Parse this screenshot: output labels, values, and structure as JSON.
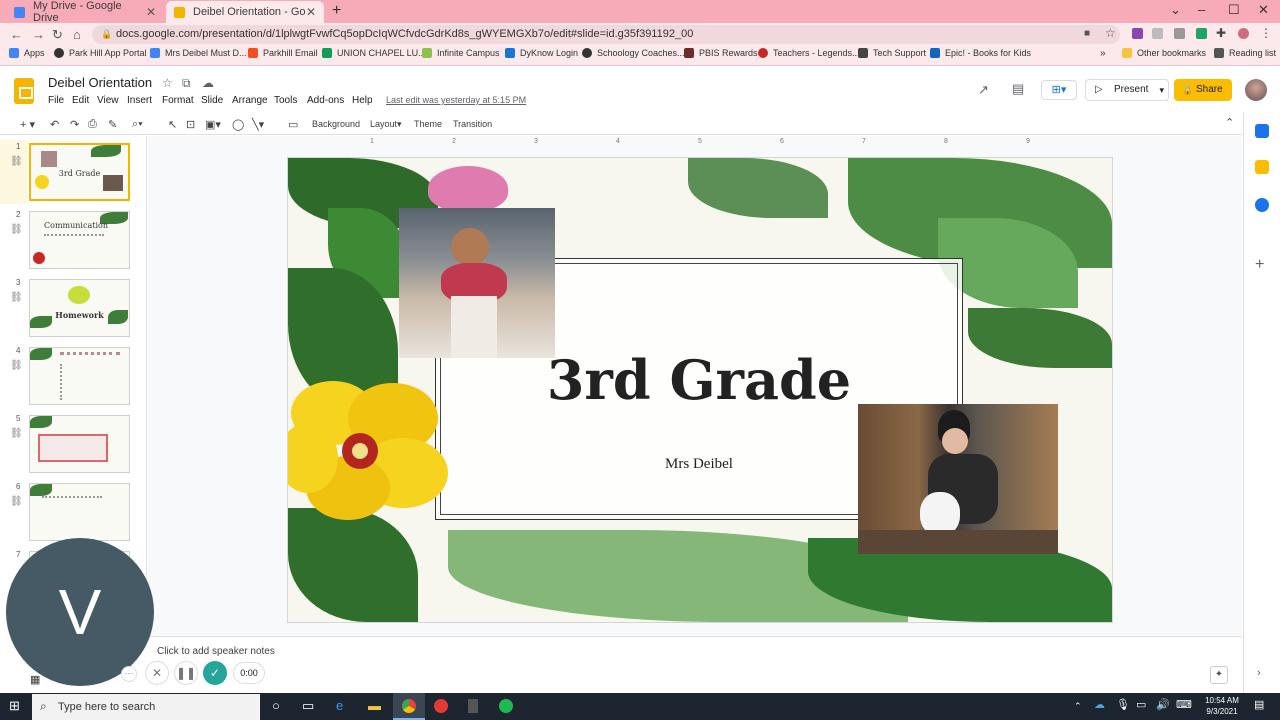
{
  "browser": {
    "tabs": [
      {
        "title": "My Drive - Google Drive",
        "color": "#4285f4"
      },
      {
        "title": "Deibel Orientation - Google Slid",
        "color": "#f4b400"
      }
    ],
    "url": "docs.google.com/presentation/d/1lplwgtFvwfCq5opDcIqWCfvdcGdrKd8s_gWYEMGXb7o/edit#slide=id.g35f391192_00",
    "bookmarks": [
      "Apps",
      "Park Hill App Portal",
      "Mrs Deibel Must D...",
      "Parkhill Email",
      "UNION CHAPEL LU...",
      "Infinite Campus",
      "DyKnow Login",
      "Schoology Coaches...",
      "PBIS Rewards",
      "Teachers - Legends...",
      "Tech Support",
      "Epic! - Books for Kids"
    ],
    "other_bookmarks": "Other bookmarks",
    "reading_list": "Reading list"
  },
  "doc": {
    "title": "Deibel Orientation",
    "menus": [
      "File",
      "Edit",
      "View",
      "Insert",
      "Format",
      "Slide",
      "Arrange",
      "Tools",
      "Add-ons",
      "Help"
    ],
    "last_edit": "Last edit was yesterday at 5:15 PM",
    "present_label": "Present",
    "share_label": "Share"
  },
  "toolbar": {
    "background": "Background",
    "layout": "Layout",
    "theme": "Theme",
    "transition": "Transition"
  },
  "filmstrip": {
    "slides": [
      {
        "num": "1",
        "title": "3rd Grade"
      },
      {
        "num": "2",
        "title": "Communication"
      },
      {
        "num": "3",
        "title": "Homework"
      },
      {
        "num": "4",
        "title": ""
      },
      {
        "num": "5",
        "title": ""
      },
      {
        "num": "6",
        "title": ""
      },
      {
        "num": "7",
        "title": ""
      }
    ]
  },
  "ruler": [
    "1",
    "2",
    "3",
    "4",
    "5",
    "6",
    "7",
    "8",
    "9"
  ],
  "slide": {
    "title": "3rd Grade",
    "subtitle": "Mrs Deibel"
  },
  "notes": {
    "placeholder": "Click to add speaker notes"
  },
  "recorder": {
    "letter": "V",
    "time": "0:00"
  },
  "taskbar": {
    "search_placeholder": "Type here to search",
    "time": "10:54 AM",
    "date": "9/3/2021"
  }
}
